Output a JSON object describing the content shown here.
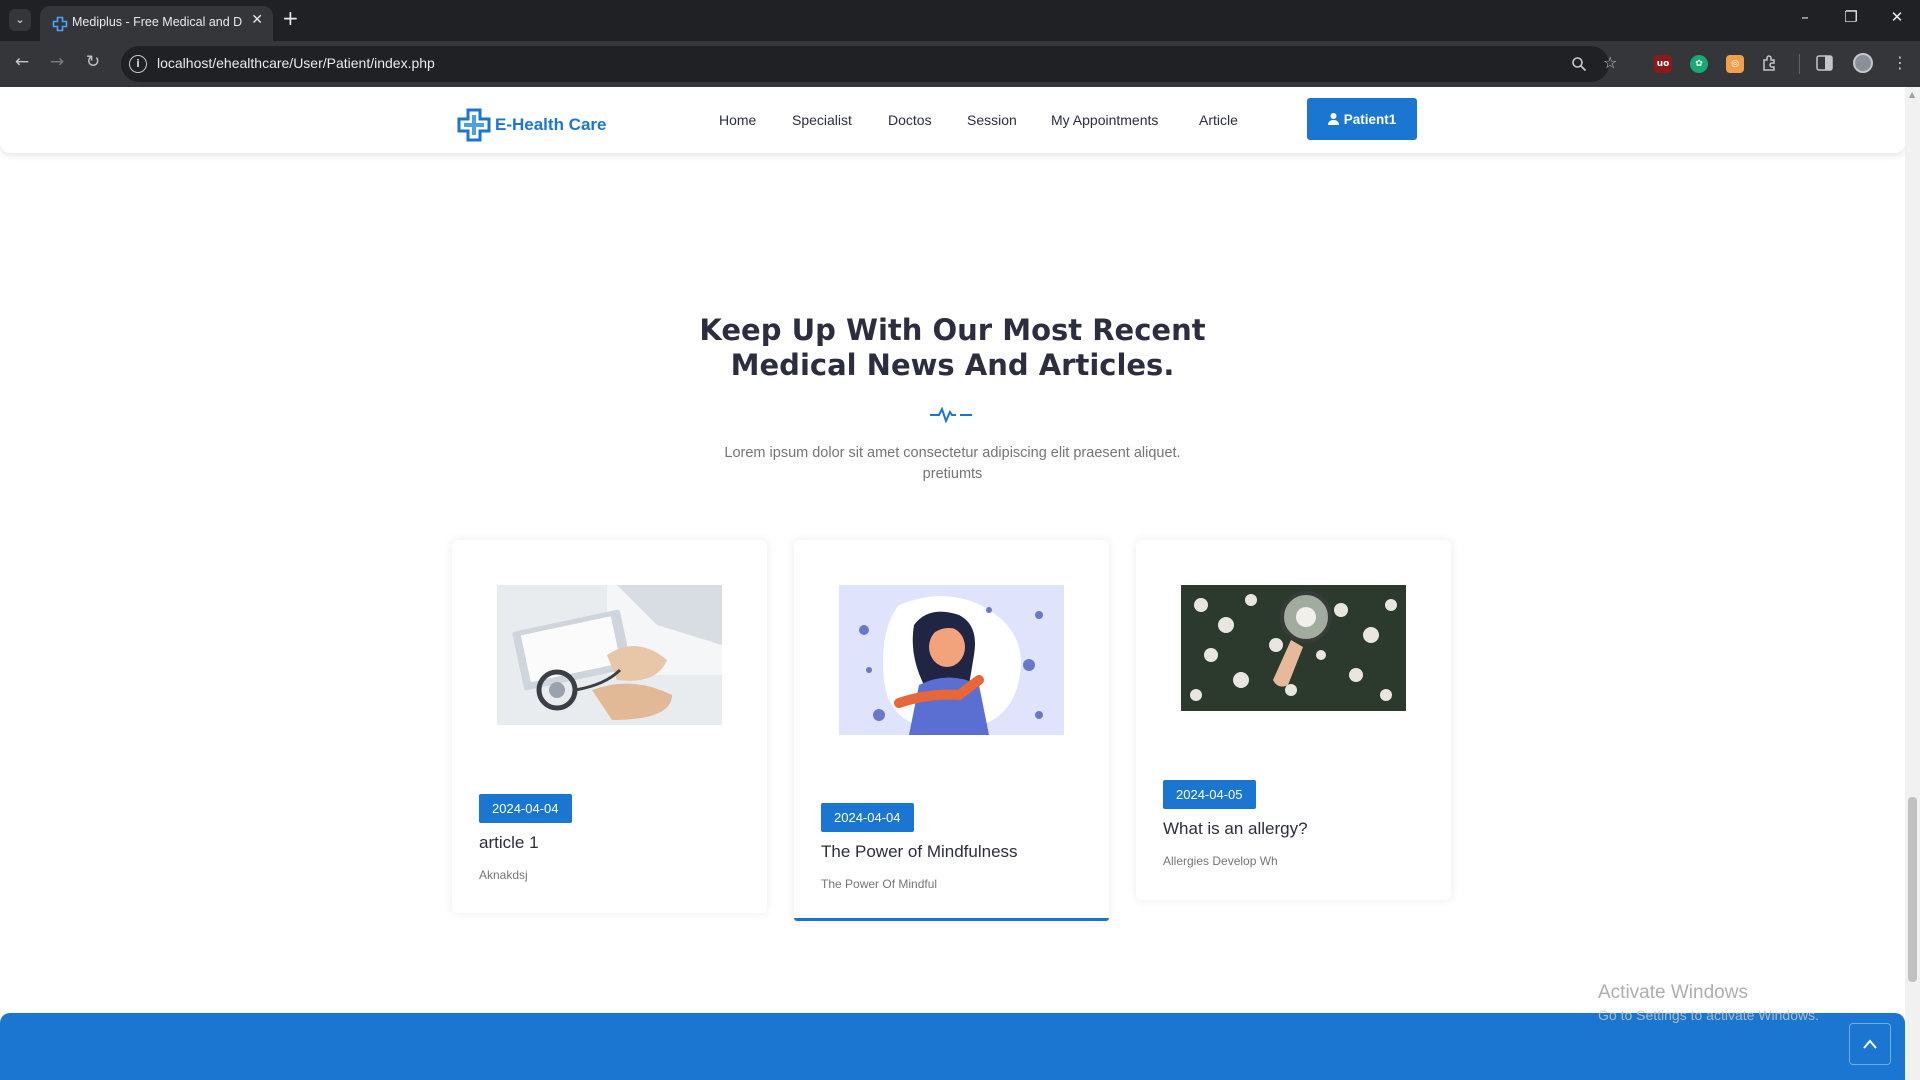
{
  "browser": {
    "tab_title": "Mediplus - Free Medical and D",
    "url": "localhost/ehealthcare/User/Patient/index.php"
  },
  "header": {
    "logo_text": "E-Health Care",
    "menu": [
      "Home",
      "Specialist",
      "Doctos",
      "Session",
      "My Appointments",
      "Article"
    ],
    "user_button": "Patient1"
  },
  "section": {
    "title_line1": "Keep Up With Our Most Recent",
    "title_line2": "Medical News And Articles.",
    "subtitle_line1": "Lorem ipsum dolor sit amet consectetur adipiscing elit praesent aliquet.",
    "subtitle_line2": "pretiumts"
  },
  "articles": [
    {
      "date": "2024-04-04",
      "title": "article 1",
      "excerpt": "Aknakdsj",
      "image_icon": "doctor-clipboard-photo"
    },
    {
      "date": "2024-04-04",
      "title": "The Power of Mindfulness",
      "excerpt": "The Power Of Mindful",
      "image_icon": "woman-illustration"
    },
    {
      "date": "2024-04-05",
      "title": "What is an allergy?",
      "excerpt": "Allergies Develop Wh",
      "image_icon": "flowers-magnifier-photo"
    }
  ],
  "watermark": {
    "title": "Activate Windows",
    "subtitle": "Go to Settings to activate Windows."
  },
  "colors": {
    "brand_blue": "#1a76d1",
    "heading": "#2c2d3f",
    "muted": "#757575"
  }
}
